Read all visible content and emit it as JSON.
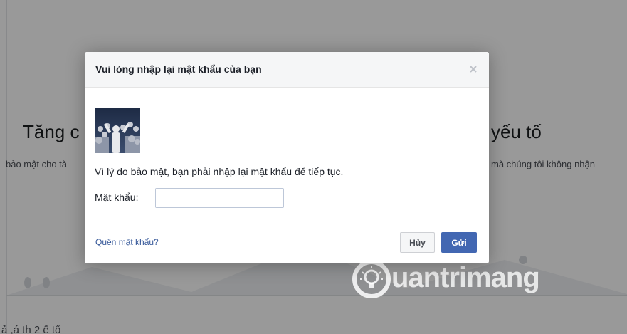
{
  "background": {
    "hero_title_left": "Tăng c",
    "hero_title_right": "yếu tố",
    "hero_sub_left": "bảo mật cho tà",
    "hero_sub_right": "mà chúng tôi không nhận",
    "bottom_text": "ả ,á th 2 ế tố"
  },
  "dialog": {
    "title": "Vui lòng nhập lại mật khẩu của bạn",
    "close_icon": "close-icon",
    "message": "Vì lý do bảo mật, bạn phải nhập lại mật khẩu để tiếp tục.",
    "password_label": "Mật khẩu:",
    "password_value": "",
    "password_placeholder": "",
    "forgot_link": "Quên mật khẩu?",
    "cancel_label": "Hủy",
    "send_label": "Gửi"
  },
  "watermark": {
    "text": "uantrimang"
  },
  "colors": {
    "primary_button": "#4267b2",
    "link": "#365899",
    "header_bg": "#f5f6f7"
  }
}
